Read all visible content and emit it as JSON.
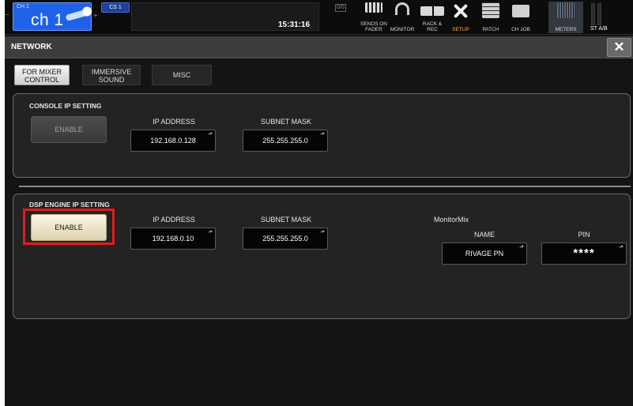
{
  "topbar": {
    "channel_small": "CH 1",
    "channel_name": "ch 1",
    "cs_label": "CS 1",
    "clock": "15:31:16",
    "mini_icon": "0/0",
    "buttons": [
      {
        "label": "SENDS ON FADER",
        "icon": "sends-on-fader-icon"
      },
      {
        "label": "MONITOR",
        "icon": "headphones-icon"
      },
      {
        "label": "RACK & REC",
        "icon": "rack-rec-icon"
      },
      {
        "label": "SETUP",
        "icon": "tools-icon",
        "active": true
      },
      {
        "label": "PATCH",
        "icon": "patch-icon"
      },
      {
        "label": "CH JOB",
        "icon": "ch-job-icon"
      },
      {
        "label": "METERS",
        "icon": "meters-icon"
      }
    ],
    "st_label": "ST A/B"
  },
  "window": {
    "title": "NETWORK",
    "close_icon": "✕"
  },
  "tabs": [
    {
      "label": "FOR MIXER CONTROL",
      "active": true
    },
    {
      "label": "IMMERSIVE SOUND",
      "active": false
    },
    {
      "label": "MISC",
      "active": false
    }
  ],
  "console_ip": {
    "title": "CONSOLE IP SETTING",
    "enable_label": "ENABLE",
    "enabled": false,
    "ip_label": "IP ADDRESS",
    "ip_value": "192.168.0.128",
    "subnet_label": "SUBNET MASK",
    "subnet_value": "255.255.255.0"
  },
  "dsp_ip": {
    "title": "DSP ENGINE IP SETTING",
    "enable_label": "ENABLE",
    "enabled": true,
    "ip_label": "IP ADDRESS",
    "ip_value": "192.168.0.10",
    "subnet_label": "SUBNET MASK",
    "subnet_value": "255.255.255.0"
  },
  "monitormix": {
    "title": "MonitorMix",
    "name_label": "NAME",
    "name_value": "RIVAGE PN",
    "pin_label": "PIN",
    "pin_value": "****"
  },
  "colors": {
    "highlight": "#e51b1b",
    "channel_blue": "#1f62e8",
    "setup_active": "#ffb24a"
  }
}
